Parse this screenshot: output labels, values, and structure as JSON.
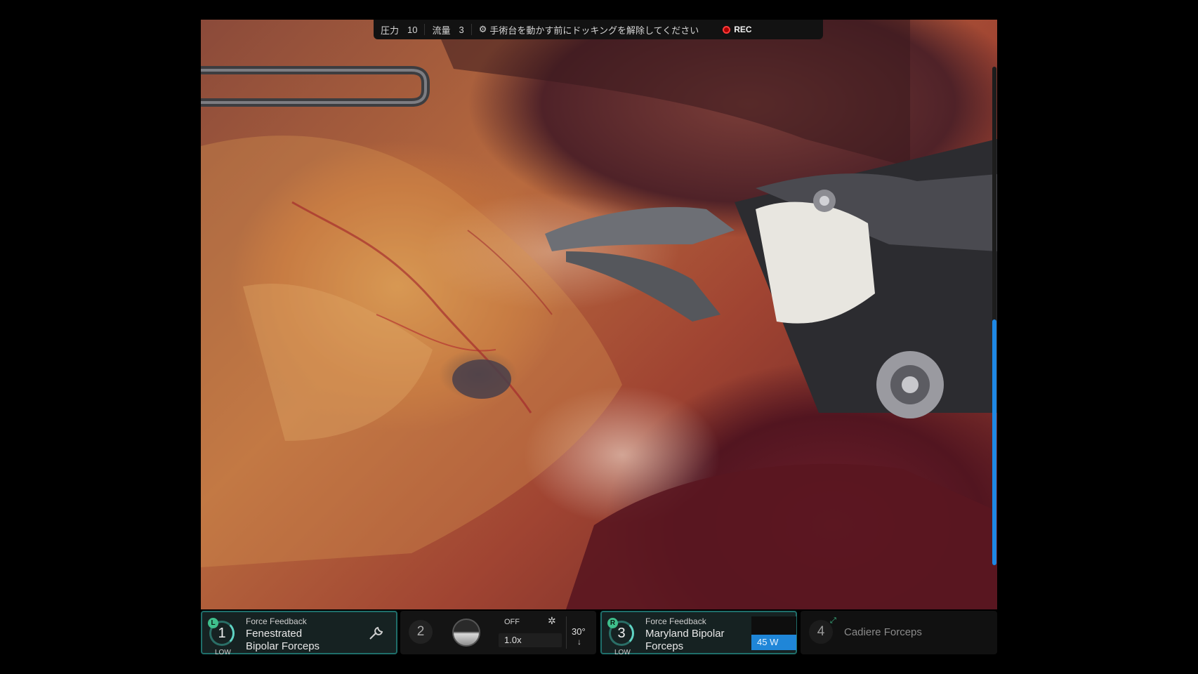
{
  "top_bar": {
    "pressure_label": "圧力",
    "pressure_value": "10",
    "flow_label": "流量",
    "flow_value": "3",
    "warning_icon": "table-icon",
    "warning_text": "手術台を動かす前にドッキングを解除してください",
    "rec_label": "REC",
    "rec_color": "#ff3b3b"
  },
  "scroll": {
    "position_fraction": 0.5
  },
  "instruments": {
    "arm1": {
      "side": "L",
      "number": "1",
      "level": "LOW",
      "feature": "Force Feedback",
      "tool_line1": "Fenestrated",
      "tool_line2": "Bipolar Forceps",
      "action_icon": "wrench-icon"
    },
    "camera": {
      "number": "2",
      "light": "OFF",
      "settings_icon": "gear-icon",
      "zoom": "1.0x",
      "angle": "30°",
      "direction": "↓"
    },
    "arm3": {
      "side": "R",
      "number": "3",
      "level": "LOW",
      "feature": "Force Feedback",
      "tool_line1": "Maryland Bipolar",
      "tool_line2": "Forceps",
      "power": "45 W",
      "power_color": "#1f86d8"
    },
    "arm4": {
      "number": "4",
      "tool": "Cadiere Forceps",
      "status_icon": "link-icon"
    }
  },
  "colors": {
    "accent": "#1e88e5",
    "active_border": "#1f6e6a",
    "teal": "#5fd3c3"
  }
}
